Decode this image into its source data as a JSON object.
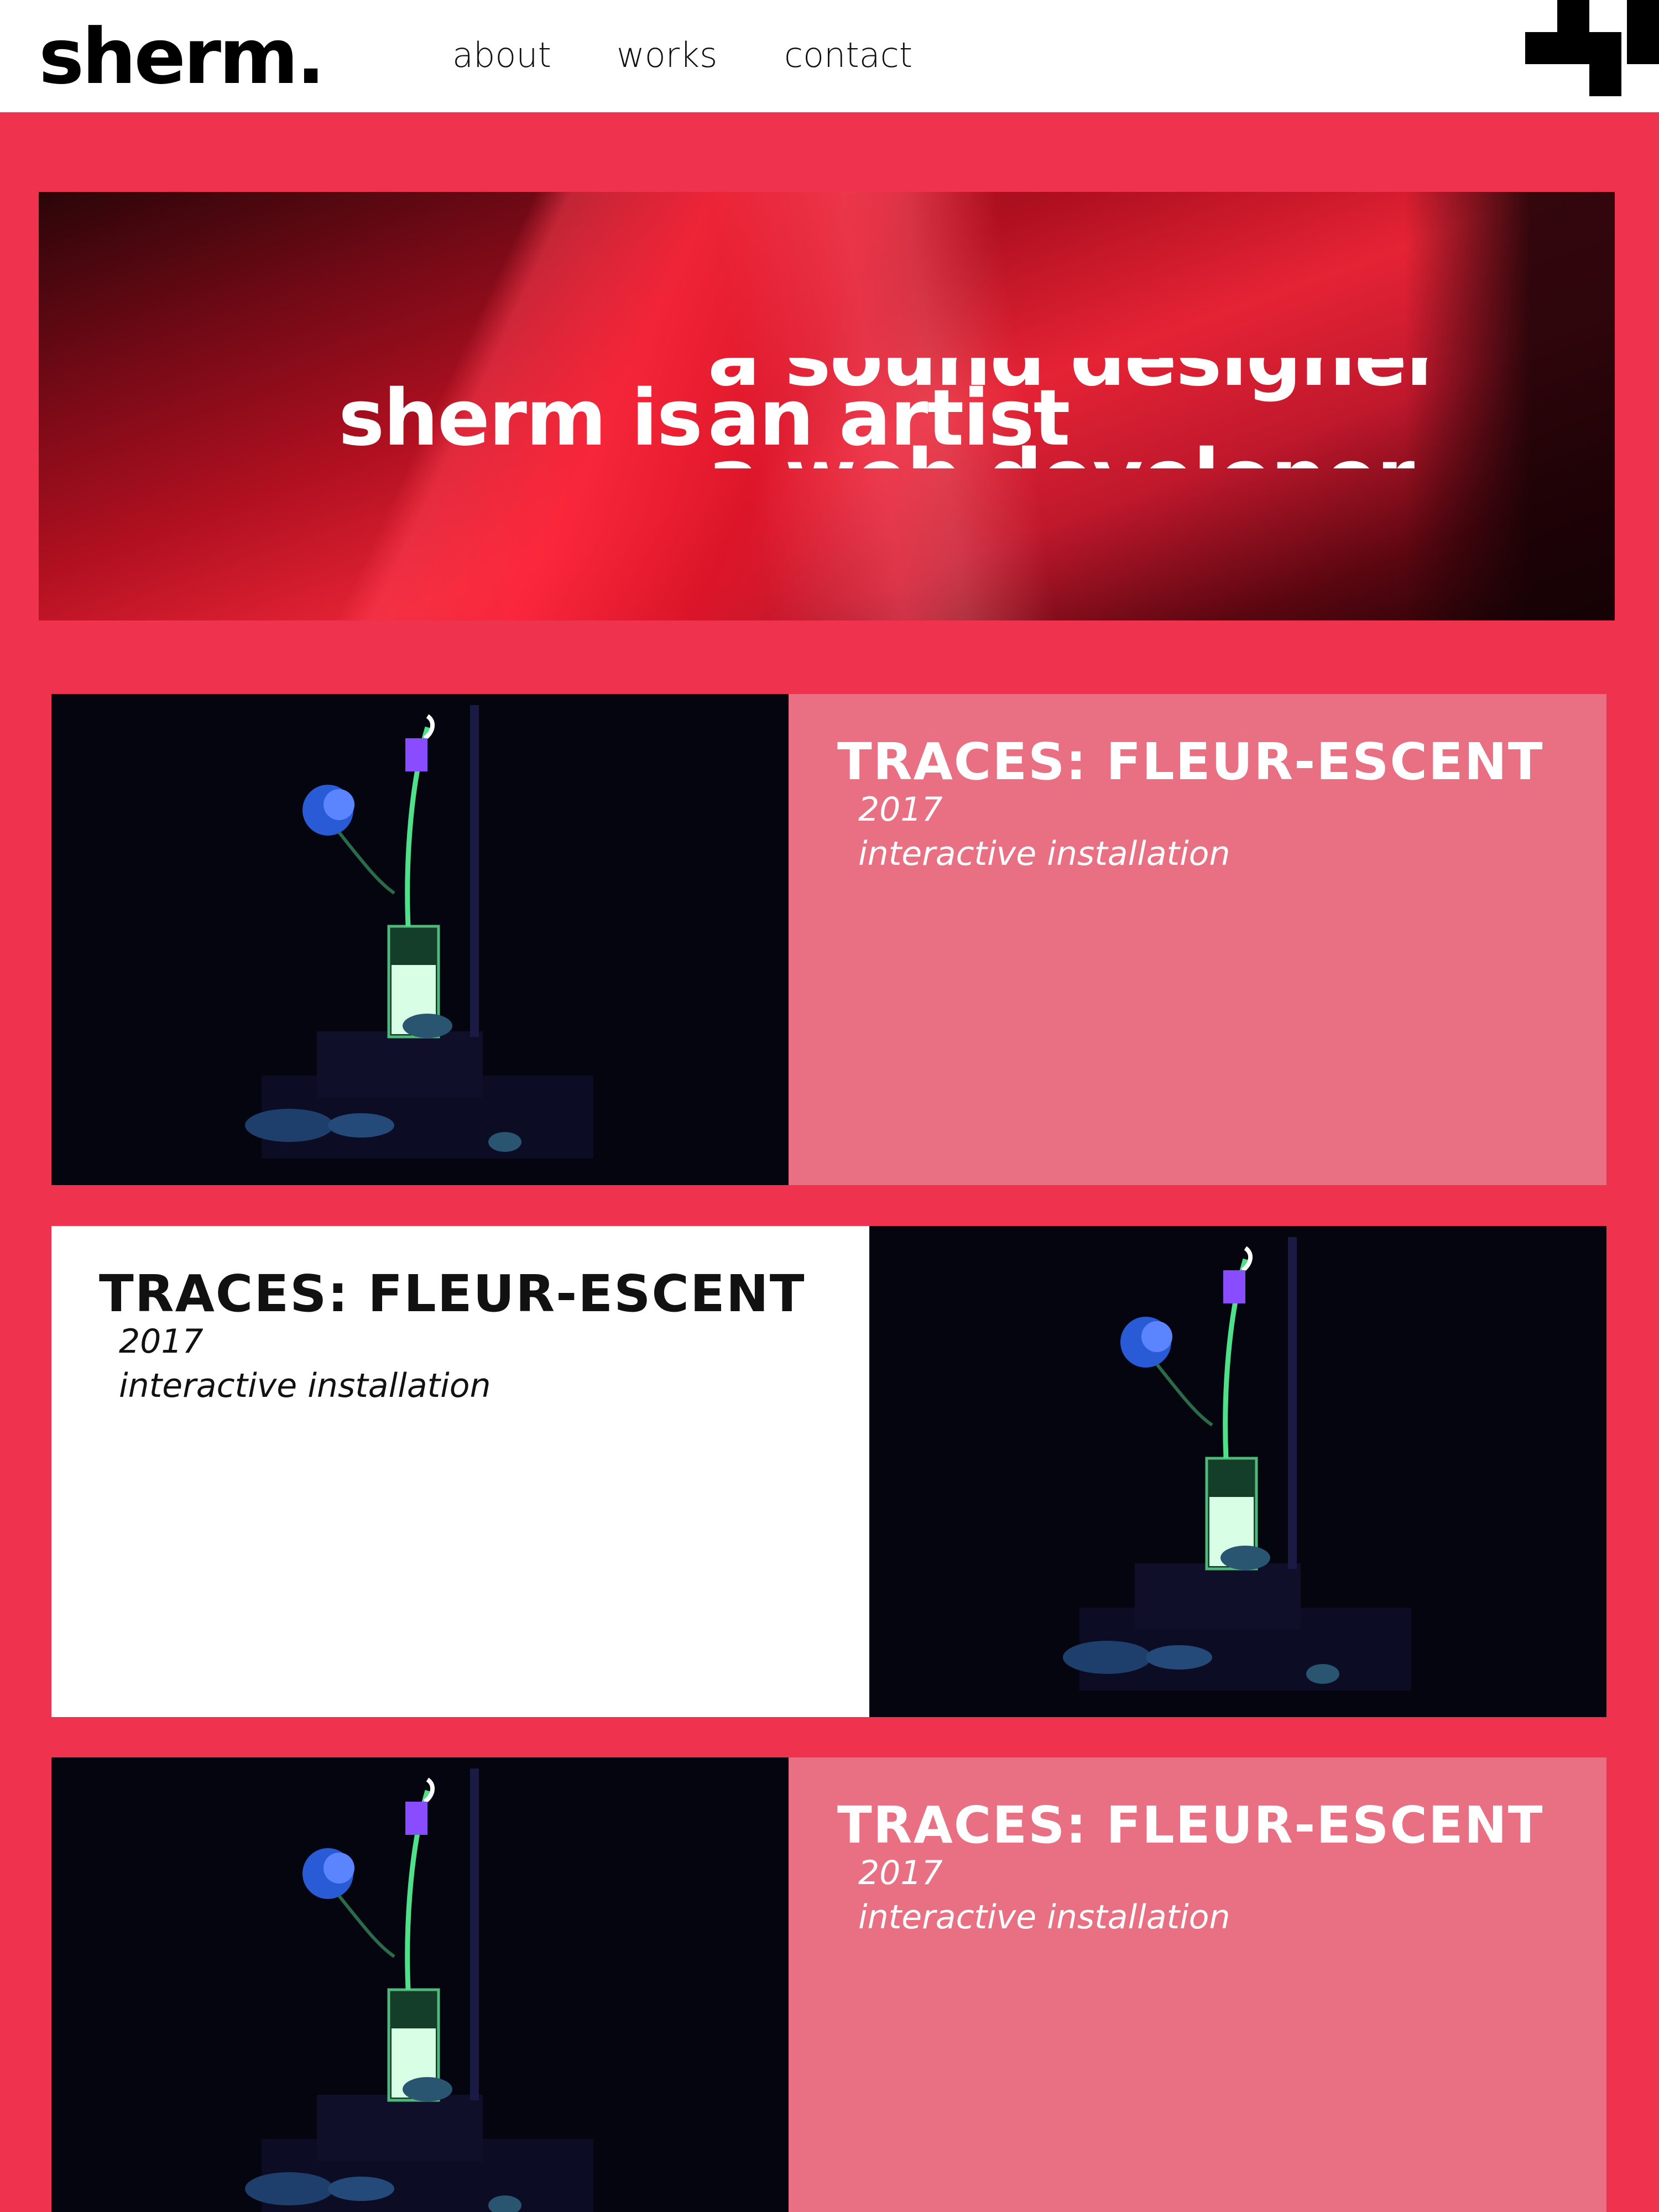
{
  "header": {
    "logo": "sherm.",
    "nav": [
      "about",
      "works",
      "contact"
    ]
  },
  "hero": {
    "prefix": "sherm is",
    "roles": [
      "a sound designer",
      "an artist",
      "a web developer"
    ]
  },
  "works": [
    {
      "title": "TRACES: FLEUR-ESCENT",
      "year": "2017",
      "kind": "interactive installation"
    },
    {
      "title": "TRACES: FLEUR-ESCENT",
      "year": "2017",
      "kind": "interactive installation"
    },
    {
      "title": "TRACES: FLEUR-ESCENT",
      "year": "2017",
      "kind": "interactive installation"
    }
  ],
  "colors": {
    "background": "#ef334f",
    "card_pink": "#e97083",
    "card_white": "#ffffff"
  }
}
